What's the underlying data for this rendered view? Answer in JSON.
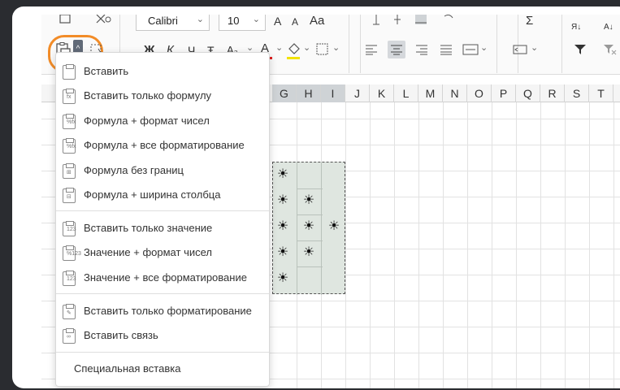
{
  "ribbon": {
    "font_name": "Calibri",
    "font_size": "10",
    "font_grow": "A",
    "font_shrink": "A",
    "change_case": "Aa",
    "bold": "Ж",
    "italic": "К",
    "underline": "Ч",
    "strike": "Ŧ",
    "subscript": "A₂",
    "font_color_letter": "A",
    "sort_asc": "Я↓",
    "sort_desc": "А↓",
    "sum": "Σ",
    "chevron": "⌄"
  },
  "colors": {
    "font_color_bar": "#e02020",
    "fill_color_bar": "#f2e200",
    "highlight_ring": "#f28c28",
    "selection_fill": "#dfe6e0"
  },
  "sheet": {
    "columns": [
      "G",
      "H",
      "I",
      "J",
      "K",
      "L",
      "M",
      "N",
      "O",
      "P",
      "Q",
      "R",
      "S",
      "T"
    ],
    "sun_glyph": "☀"
  },
  "paste_menu": {
    "items": [
      {
        "label": "Вставить",
        "icon": "paste-icon"
      },
      {
        "label": "Вставить только формулу",
        "icon": "paste-formula-icon"
      },
      {
        "label": "Формула + формат чисел",
        "icon": "paste-formula-number-format-icon"
      },
      {
        "label": "Формула + все форматирование",
        "icon": "paste-formula-all-formatting-icon"
      },
      {
        "label": "Формула без границ",
        "icon": "paste-formula-no-borders-icon"
      },
      {
        "label": "Формула + ширина столбца",
        "icon": "paste-formula-column-width-icon"
      },
      {
        "label": "Вставить только значение",
        "icon": "paste-values-icon"
      },
      {
        "label": "Значение + формат чисел",
        "icon": "paste-values-number-format-icon"
      },
      {
        "label": "Значение + все форматирование",
        "icon": "paste-values-all-formatting-icon"
      },
      {
        "label": "Вставить только форматирование",
        "icon": "paste-formatting-icon"
      },
      {
        "label": "Вставить связь",
        "icon": "paste-link-icon"
      }
    ],
    "special": "Специальная вставка"
  }
}
